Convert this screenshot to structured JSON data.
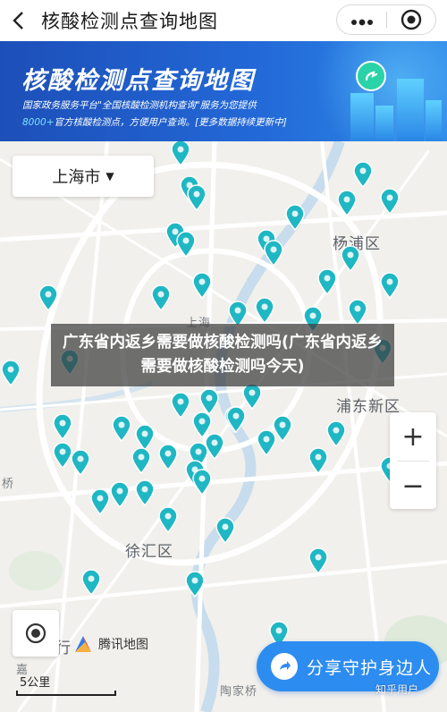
{
  "navbar": {
    "title": "核酸检测点查询地图",
    "back_icon": "chevron-left-icon",
    "more_icon": "more-dots-icon",
    "close_icon": "target-close-icon"
  },
  "banner": {
    "title": "核酸检测点查询地图",
    "line1": "国家政务服务平台\"全国核酸检测机构查询\"服务为您提供",
    "line2_highlight": "8000+",
    "line2_rest": "官方核酸检测点，方便用户查询。[更多数据持续更新中]",
    "colors": {
      "start": "#1d4fb8",
      "end": "#2d88e8",
      "badge": "#2ad2a8"
    }
  },
  "map": {
    "city_selector": {
      "label": "上海市",
      "caret": "▼"
    },
    "districts": [
      {
        "name": "杨浦区",
        "size": "large"
      },
      {
        "name": "浦东新区",
        "size": "large"
      },
      {
        "name": "徐汇区",
        "size": "large"
      },
      {
        "name": "上海",
        "size": "small"
      },
      {
        "name": "桥",
        "size": "small"
      },
      {
        "name": "陶家桥",
        "size": "small"
      },
      {
        "name": "嘉",
        "size": "small"
      },
      {
        "name": "行",
        "size": "large"
      }
    ],
    "pin_color": "#1fb7c3",
    "zoom": {
      "plus": "+",
      "minus": "−"
    },
    "locate_icon": "locate-icon",
    "share_button": {
      "label": "分享守护身边人",
      "icon": "share-icon"
    },
    "logo": {
      "name": "腾讯地图"
    },
    "scale": {
      "label": "5公里"
    }
  },
  "caption": {
    "text": "广东省内返乡需要做核酸检测吗(广东省内返乡需要做核酸检测吗今天)"
  },
  "watermark": "知乎用户"
}
